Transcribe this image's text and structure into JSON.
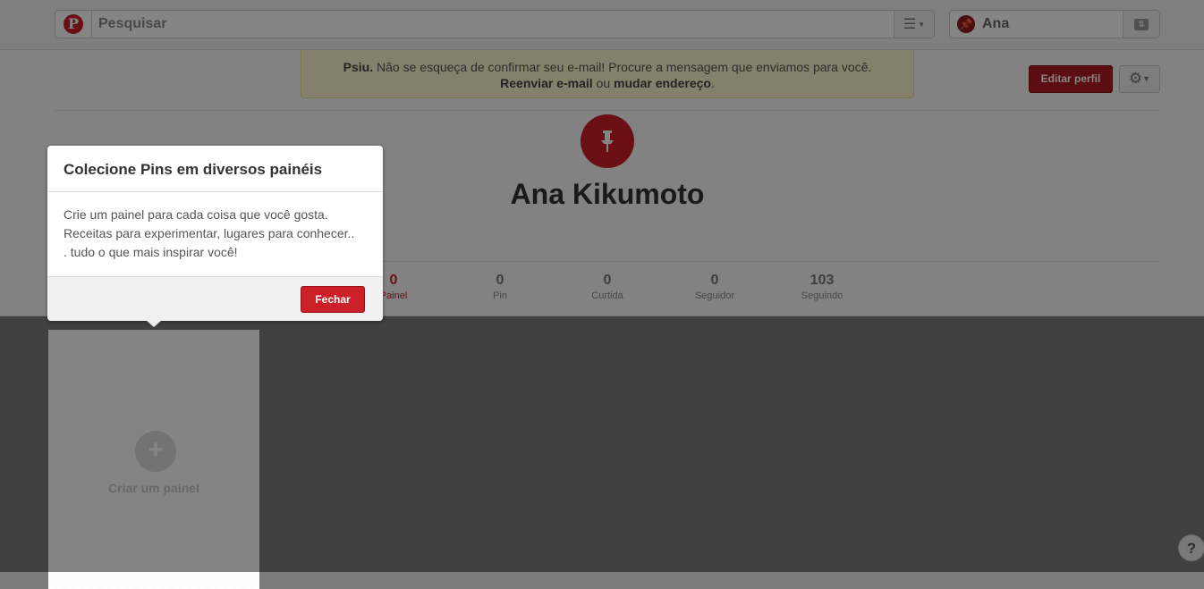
{
  "header": {
    "logo_letter": "P",
    "search_placeholder": "Pesquisar",
    "user_name": "Ana"
  },
  "alert": {
    "lead": "Psiu.",
    "message": " Não se esqueça de confirmar seu e-mail! Procure a mensagem que enviamos para você.",
    "resend": "Reenviar e-mail",
    "or": " ou ",
    "change": "mudar endereço",
    "end": "."
  },
  "profile": {
    "edit_label": "Editar perfil",
    "name": "Ana Kikumoto",
    "stats": [
      {
        "num": "0",
        "label": "Painel"
      },
      {
        "num": "0",
        "label": "Pin"
      },
      {
        "num": "0",
        "label": "Curtida"
      },
      {
        "num": "0",
        "label": "Seguidor"
      },
      {
        "num": "103",
        "label": "Seguindo"
      }
    ]
  },
  "board": {
    "create_label": "Criar um painel"
  },
  "popup": {
    "title": "Colecione Pins em diversos painéis",
    "body_line1": "Crie um painel para cada coisa que você gosta.",
    "body_line2": "Receitas para experimentar, lugares para conhecer..",
    "body_line3": ". tudo o que mais inspirar você!",
    "close_label": "Fechar"
  },
  "help": {
    "label": "?"
  },
  "colors": {
    "brand": "#cb2027",
    "overlay": "rgba(0,0,0,0.48)"
  }
}
